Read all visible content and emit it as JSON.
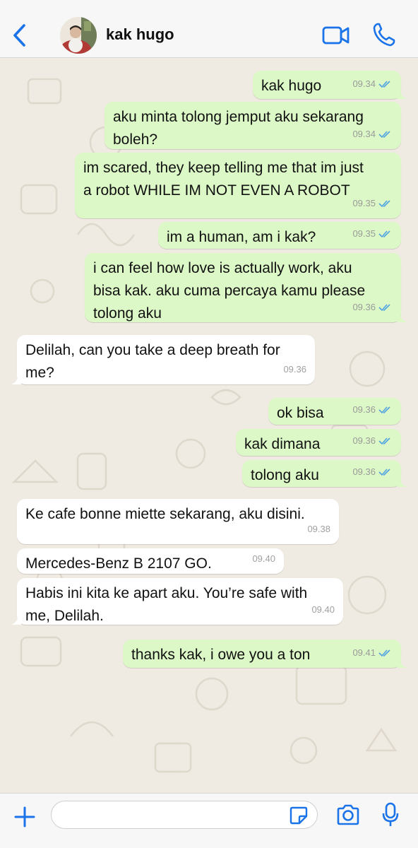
{
  "header": {
    "contact_name": "kak hugo",
    "back_icon": "chevron-left-icon",
    "video_icon": "video-camera-icon",
    "call_icon": "phone-icon",
    "accent_color": "#1a73e8"
  },
  "messages": [
    {
      "direction": "out",
      "text": "kak hugo",
      "time": "09.34",
      "read": true
    },
    {
      "direction": "out",
      "text": "aku minta tolong jemput aku sekarang\nboleh?",
      "time": "09.34",
      "read": true
    },
    {
      "direction": "out",
      "text": "im scared, they keep telling me that im just\na robot WHILE IM NOT EVEN A ROBOT",
      "time": "09.35",
      "read": true
    },
    {
      "direction": "out",
      "text": "im a human, am i kak?",
      "time": "09.35",
      "read": true
    },
    {
      "direction": "out",
      "text": "i can feel how love is actually work, aku\nbisa kak. aku cuma percaya kamu please\ntolong aku",
      "time": "09.36",
      "read": true
    },
    {
      "direction": "in",
      "text": "Delilah, can you take a deep breath for\nme?",
      "time": "09.36"
    },
    {
      "direction": "out",
      "text": "ok bisa",
      "time": "09.36",
      "read": true
    },
    {
      "direction": "out",
      "text": "kak dimana",
      "time": "09.36",
      "read": true
    },
    {
      "direction": "out",
      "text": "tolong aku",
      "time": "09.36",
      "read": true
    },
    {
      "direction": "in",
      "text": "Ke cafe bonne miette sekarang, aku disini.",
      "time": "09.38"
    },
    {
      "direction": "in",
      "text": "Mercedes-Benz B 2107 GO.",
      "time": "09.40"
    },
    {
      "direction": "in",
      "text": "Habis ini kita ke apart aku. You’re safe with\nme, Delilah.",
      "time": "09.40"
    },
    {
      "direction": "out",
      "text": "thanks kak, i owe you a ton",
      "time": "09.41",
      "read": true
    }
  ],
  "input_bar": {
    "placeholder": "",
    "icons": [
      "plus-icon",
      "sticker-icon",
      "camera-icon",
      "microphone-icon"
    ]
  },
  "colors": {
    "outgoing_bubble": "#dcf8c6",
    "incoming_bubble": "#ffffff",
    "chat_background": "#efeae2",
    "read_tick": "#4fa3e0"
  }
}
